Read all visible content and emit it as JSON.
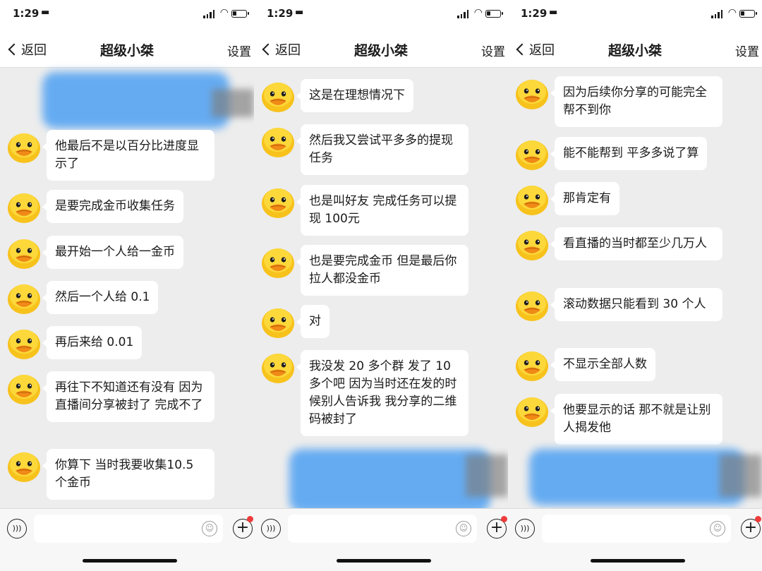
{
  "screens": [
    {
      "status": {
        "time": "1:29"
      },
      "nav": {
        "back_label": "返回",
        "title": "超级小桀",
        "settings_label": "设置"
      },
      "messages": [
        "他最后不是以百分比进度显示了",
        "是要完成金币收集任务",
        "最开始一个人给一金币",
        "然后一个人给 0.1",
        "再后来给 0.01",
        "再往下不知道还有没有 因为直播间分享被封了 完成不了",
        "你算下 当时我要收集10.5 个金币"
      ]
    },
    {
      "status": {
        "time": "1:29"
      },
      "nav": {
        "back_label": "返回",
        "title": "超级小桀",
        "settings_label": "设置"
      },
      "messages": [
        "这是在理想情况下",
        "然后我又尝试平多多的提现任务",
        "也是叫好友 完成任务可以提现 100元",
        "也是要完成金币 但是最后你拉人都没金币",
        "对",
        "我没发 20 多个群 发了 10 多个吧 因为当时还在发的时候别人告诉我 我分享的二维码被封了"
      ]
    },
    {
      "status": {
        "time": "1:29"
      },
      "nav": {
        "back_label": "返回",
        "title": "超级小桀",
        "settings_label": "设置"
      },
      "messages": [
        "因为后续你分享的可能完全帮不到你",
        "能不能帮到 平多多说了算",
        "那肯定有",
        "看直播的当时都至少几万人",
        "滚动数据只能看到 30 个人",
        "不显示全部人数",
        "他要显示的话 那不就是让别人揭发他"
      ]
    }
  ],
  "colors": {
    "bubble": "#ffffff",
    "chat_bg": "#ededed",
    "redaction": "#5aa6f2",
    "badge": "#ef3b3b"
  },
  "icons": [
    "duck-avatar-icon",
    "voice-icon",
    "emoji-icon",
    "plus-icon",
    "wifi-icon",
    "battery-icon",
    "signal-icon",
    "car-icon",
    "back-chevron-icon"
  ]
}
